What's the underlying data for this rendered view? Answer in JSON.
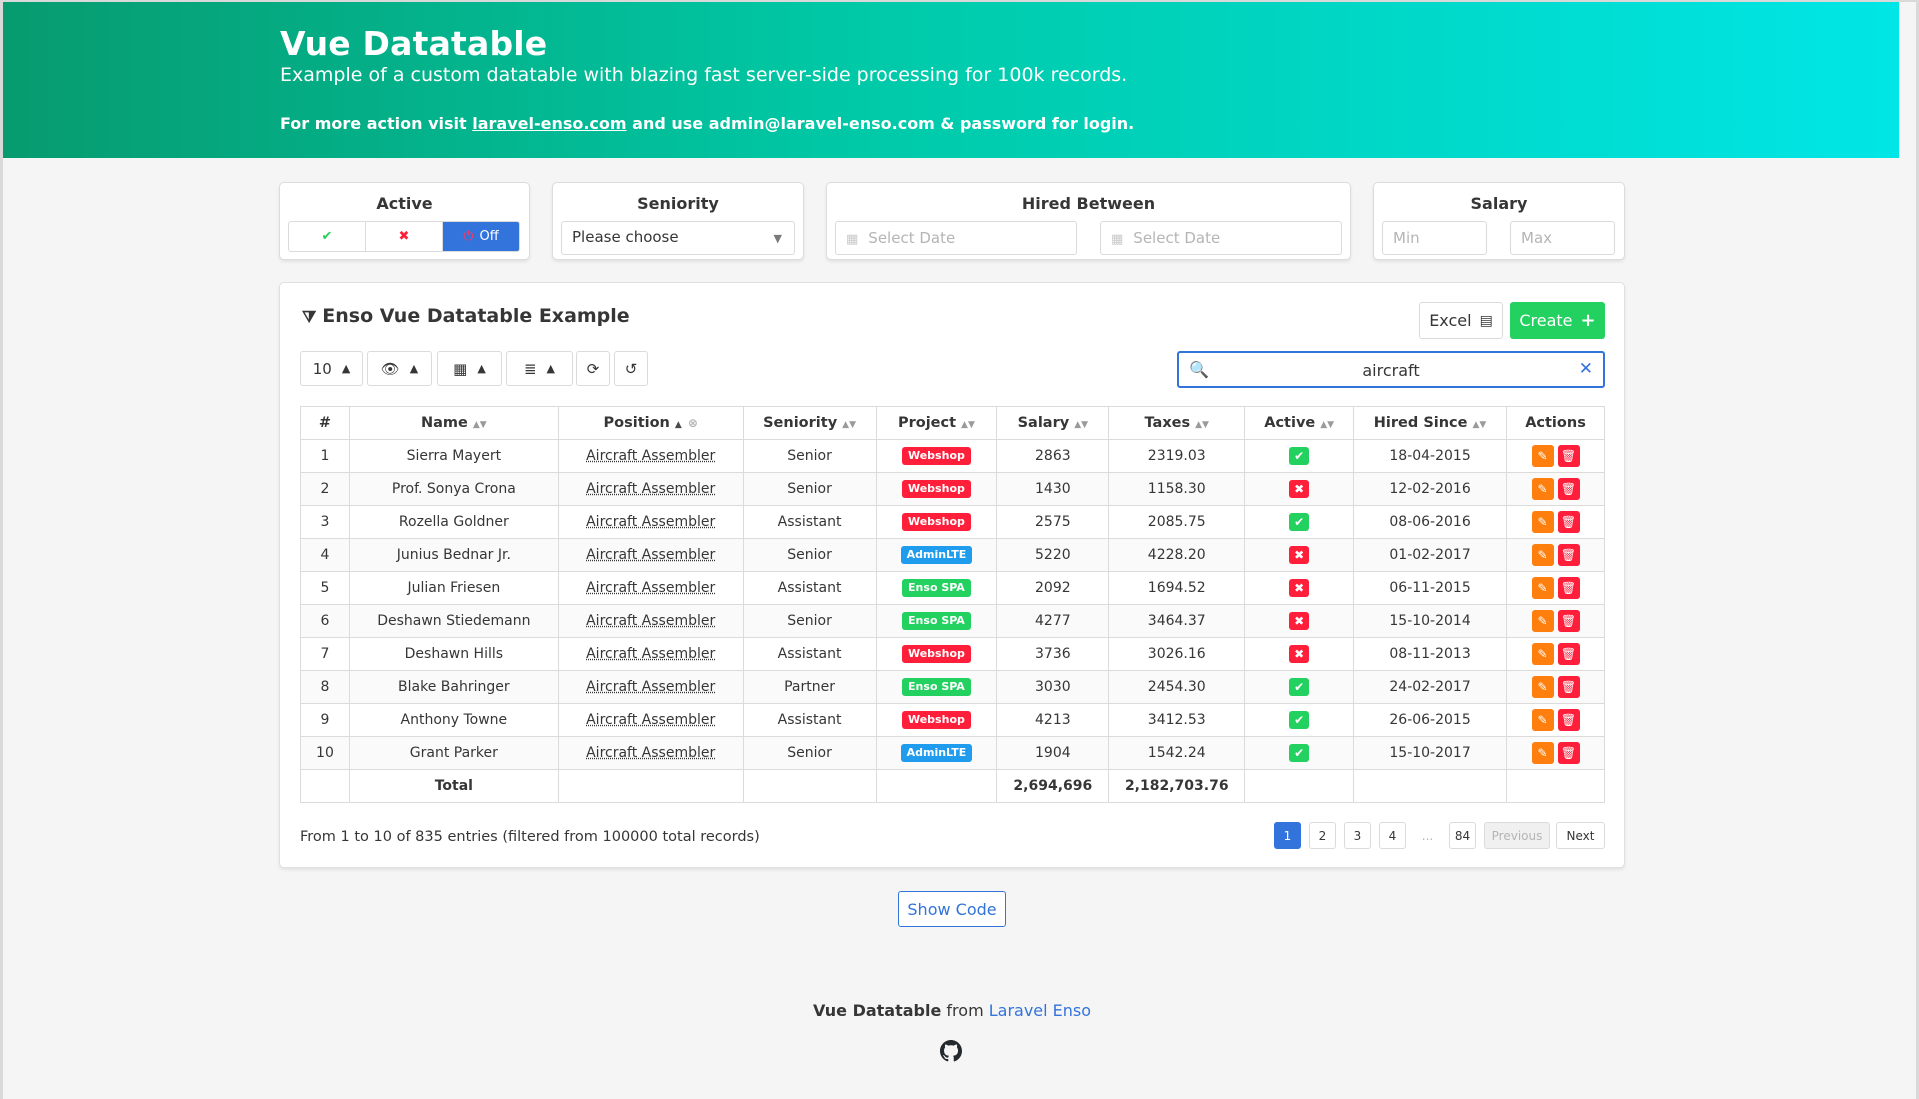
{
  "hero": {
    "title": "Vue Datatable",
    "subtitle": "Example of a custom datatable with blazing fast server-side processing for 100k records.",
    "note_prefix": "For more action visit ",
    "note_link": "laravel-enso.com",
    "note_suffix": " and use admin@laravel-enso.com & password for login."
  },
  "filters": {
    "active": {
      "title": "Active",
      "yes_icon": "check-icon",
      "no_icon": "x-icon",
      "off_label": "Off",
      "off_icon": "power-icon"
    },
    "seniority": {
      "title": "Seniority",
      "placeholder": "Please choose"
    },
    "hired": {
      "title": "Hired Between",
      "from_placeholder": "Select Date",
      "to_placeholder": "Select Date"
    },
    "salary": {
      "title": "Salary",
      "min_placeholder": "Min",
      "max_placeholder": "Max"
    }
  },
  "card": {
    "title": "Enso Vue Datatable Example",
    "excel_label": "Excel",
    "create_label": "Create",
    "page_length": "10",
    "search_value": "aircraft"
  },
  "table": {
    "columns": [
      "#",
      "Name",
      "Position",
      "Seniority",
      "Project",
      "Salary",
      "Taxes",
      "Active",
      "Hired Since",
      "Actions"
    ],
    "rows": [
      {
        "n": "1",
        "name": "Sierra Mayert",
        "position": "Aircraft Assembler",
        "seniority": "Senior",
        "project": "Webshop",
        "salary": "2863",
        "taxes": "2319.03",
        "active": true,
        "hired": "18-04-2015"
      },
      {
        "n": "2",
        "name": "Prof. Sonya Crona",
        "position": "Aircraft Assembler",
        "seniority": "Senior",
        "project": "Webshop",
        "salary": "1430",
        "taxes": "1158.30",
        "active": false,
        "hired": "12-02-2016"
      },
      {
        "n": "3",
        "name": "Rozella Goldner",
        "position": "Aircraft Assembler",
        "seniority": "Assistant",
        "project": "Webshop",
        "salary": "2575",
        "taxes": "2085.75",
        "active": true,
        "hired": "08-06-2016"
      },
      {
        "n": "4",
        "name": "Junius Bednar Jr.",
        "position": "Aircraft Assembler",
        "seniority": "Senior",
        "project": "AdminLTE",
        "salary": "5220",
        "taxes": "4228.20",
        "active": false,
        "hired": "01-02-2017"
      },
      {
        "n": "5",
        "name": "Julian Friesen",
        "position": "Aircraft Assembler",
        "seniority": "Assistant",
        "project": "Enso SPA",
        "salary": "2092",
        "taxes": "1694.52",
        "active": false,
        "hired": "06-11-2015"
      },
      {
        "n": "6",
        "name": "Deshawn Stiedemann",
        "position": "Aircraft Assembler",
        "seniority": "Senior",
        "project": "Enso SPA",
        "salary": "4277",
        "taxes": "3464.37",
        "active": false,
        "hired": "15-10-2014"
      },
      {
        "n": "7",
        "name": "Deshawn Hills",
        "position": "Aircraft Assembler",
        "seniority": "Assistant",
        "project": "Webshop",
        "salary": "3736",
        "taxes": "3026.16",
        "active": false,
        "hired": "08-11-2013"
      },
      {
        "n": "8",
        "name": "Blake Bahringer",
        "position": "Aircraft Assembler",
        "seniority": "Partner",
        "project": "Enso SPA",
        "salary": "3030",
        "taxes": "2454.30",
        "active": true,
        "hired": "24-02-2017"
      },
      {
        "n": "9",
        "name": "Anthony Towne",
        "position": "Aircraft Assembler",
        "seniority": "Assistant",
        "project": "Webshop",
        "salary": "4213",
        "taxes": "3412.53",
        "active": true,
        "hired": "26-06-2015"
      },
      {
        "n": "10",
        "name": "Grant Parker",
        "position": "Aircraft Assembler",
        "seniority": "Senior",
        "project": "AdminLTE",
        "salary": "1904",
        "taxes": "1542.24",
        "active": true,
        "hired": "15-10-2017"
      }
    ],
    "total_label": "Total",
    "total_salary": "2,694,696",
    "total_taxes": "2,182,703.76"
  },
  "project_colors": {
    "Webshop": "#ff1f3a",
    "AdminLTE": "#209cee",
    "Enso SPA": "#23d160"
  },
  "status_colors": {
    "active": "#23d160",
    "inactive": "#ff1f3a"
  },
  "entries_text": "From 1 to 10 of 835 entries (filtered from 100000 total records)",
  "pagination": {
    "pages": [
      "1",
      "2",
      "3",
      "4"
    ],
    "ellipsis": "...",
    "last": "84",
    "prev": "Previous",
    "next": "Next",
    "current": "1"
  },
  "show_code_label": "Show Code",
  "footer": {
    "brand": "Vue Datatable",
    "from": " from ",
    "link": "Laravel Enso",
    "icon": "github-icon"
  }
}
